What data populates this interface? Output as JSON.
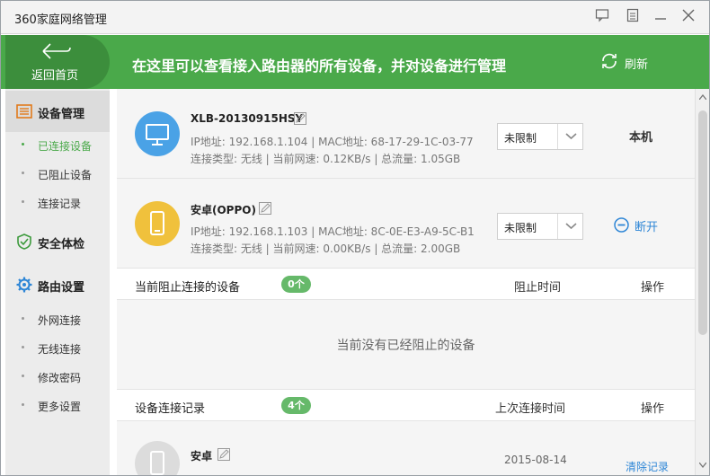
{
  "window": {
    "title": "360家庭网络管理",
    "buttons": [
      "feedback-icon",
      "menu-icon",
      "minimize-icon",
      "close-icon"
    ]
  },
  "header": {
    "home_label": "返回首页",
    "message": "在这里可以查看接入路由器的所有设备，并对设备进行管理",
    "refresh_label": "刷新",
    "accent": "#4aa94a"
  },
  "sidebar": {
    "groups": [
      {
        "label": "设备管理",
        "icon": "device-list-icon",
        "items": [
          "已连接设备",
          "已阻止设备",
          "连接记录"
        ],
        "current": "已连接设备"
      },
      {
        "label": "安全体检",
        "icon": "shield-icon",
        "items": []
      },
      {
        "label": "路由设置",
        "icon": "gear-icon",
        "items": [
          "外网连接",
          "无线连接",
          "修改密码",
          "更多设置"
        ]
      }
    ]
  },
  "devices": [
    {
      "name": "XLB-20130915HSY",
      "line1": "IP地址: 192.168.1.104 | MAC地址: 68-17-29-1C-03-77",
      "line2": "连接类型: 无线 | 当前网速: 0.12KB/s | 总流量: 1.05GB",
      "limit": "未限制",
      "action": "本机",
      "icon": "monitor-icon"
    },
    {
      "name": "安卓(OPPO)",
      "line1": "IP地址: 192.168.1.103 | MAC地址: 8C-0E-E3-A9-5C-B1",
      "line2": "连接类型: 无线 | 当前网速: 0.00KB/s | 总流量: 2.00GB",
      "limit": "未限制",
      "action": "断开",
      "icon": "phone-icon"
    }
  ],
  "blocked": {
    "title": "当前阻止连接的设备",
    "count": "0个",
    "col_time": "阻止时间",
    "col_action": "操作",
    "empty": "当前没有已经阻止的设备"
  },
  "history": {
    "title": "设备连接记录",
    "count": "4个",
    "col_time": "上次连接时间",
    "col_action": "操作",
    "rows": [
      {
        "name": "安卓",
        "date": "2015-08-14",
        "action": "清除记录"
      }
    ]
  }
}
